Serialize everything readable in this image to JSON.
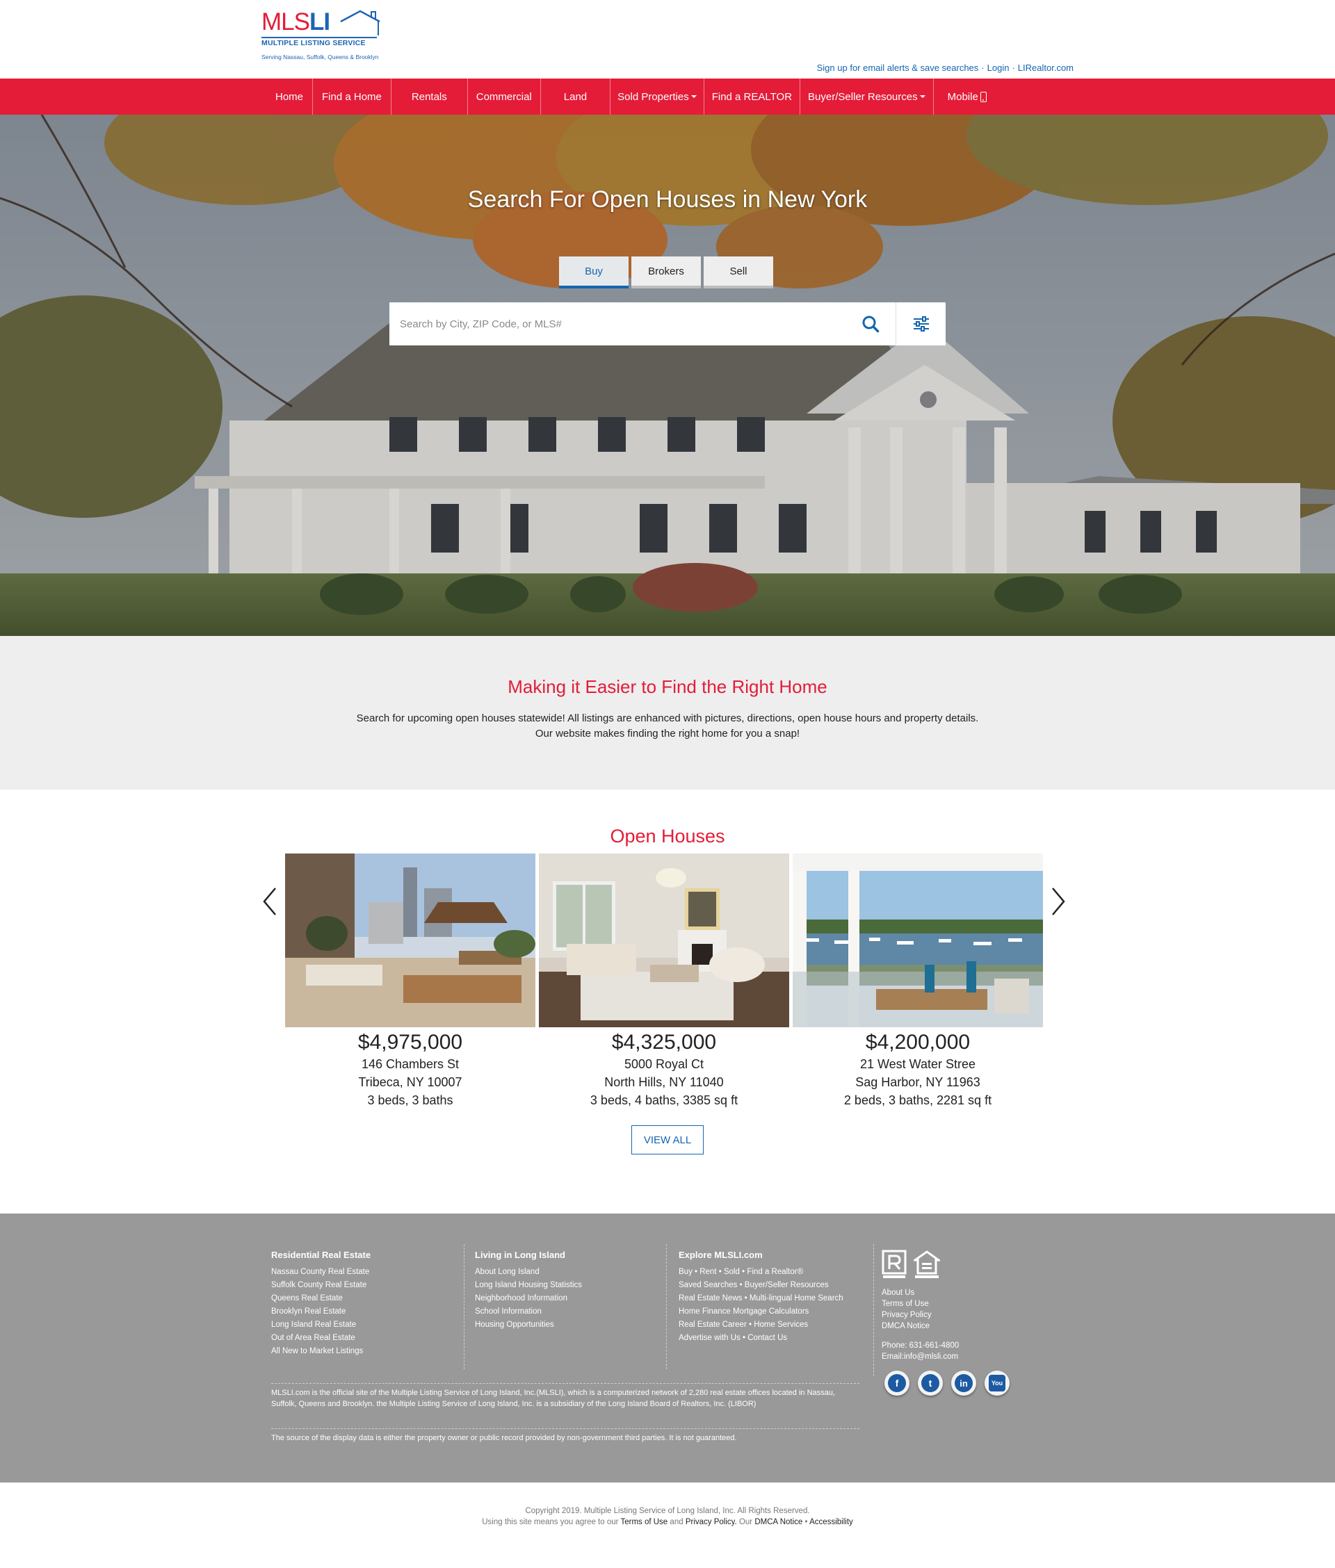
{
  "header": {
    "logo": {
      "mls": "MLS",
      "li": "LI",
      "tagline": "MULTIPLE LISTING SERVICE",
      "serving": "Serving Nassau, Suffolk, Queens & Brooklyn"
    },
    "utility_links": [
      "Sign up for email alerts & save searches",
      "Login",
      "LIRealtor.com"
    ]
  },
  "nav": {
    "items": [
      {
        "label": "Home"
      },
      {
        "label": "Find a Home"
      },
      {
        "label": "Rentals"
      },
      {
        "label": "Commercial"
      },
      {
        "label": "Land"
      },
      {
        "label": "Sold Properties"
      },
      {
        "label": "Find a REALTOR"
      },
      {
        "label": "Buyer/Seller Resources"
      },
      {
        "label": "Mobile"
      }
    ]
  },
  "hero": {
    "title": "Search For Open Houses in New York",
    "tabs": [
      {
        "label": "Buy",
        "active": true
      },
      {
        "label": "Brokers",
        "active": false
      },
      {
        "label": "Sell",
        "active": false
      }
    ],
    "search": {
      "placeholder": "Search by City, ZIP Code, or MLS#",
      "value": ""
    }
  },
  "intro": {
    "heading": "Making it Easier to Find the Right Home",
    "line1": "Search for upcoming open houses statewide! All listings are enhanced with pictures, directions, open house hours and property details.",
    "line2": "Our website makes finding the right home for you a snap!"
  },
  "open_houses": {
    "heading": "Open Houses",
    "view_all": "VIEW ALL",
    "listings": [
      {
        "price": "$4,975,000",
        "street": "146 Chambers St",
        "city": "Tribeca, NY 10007",
        "details": "3 beds, 3 baths"
      },
      {
        "price": "$4,325,000",
        "street": "5000 Royal Ct",
        "city": "North Hills, NY 11040",
        "details": "3 beds, 4 baths, 3385 sq ft"
      },
      {
        "price": "$4,200,000",
        "street": "21 West Water Stree",
        "city": "Sag Harbor, NY 11963",
        "details": "2 beds, 3 baths, 2281 sq ft"
      }
    ]
  },
  "footer": {
    "col1": {
      "title": "Residential Real Estate",
      "links": [
        "Nassau County Real Estate",
        "Suffolk County Real Estate",
        "Queens Real Estate",
        "Brooklyn Real Estate",
        "Long Island Real Estate",
        "Out of Area Real Estate",
        "All New to Market Listings"
      ]
    },
    "col2": {
      "title": "Living in Long Island",
      "links": [
        "About Long Island",
        "Long Island Housing Statistics",
        "Neighborhood Information",
        "School Information",
        "Housing Opportunities"
      ]
    },
    "col3": {
      "title": "Explore MLSLI.com",
      "links": [
        "Buy • Rent • Sold • Find a Realtor®",
        "Saved Searches • Buyer/Seller Resources",
        "Real Estate News • Multi-lingual Home Search",
        "Home Finance Mortgage Calculators",
        "Real Estate Career • Home Services",
        "Advertise with Us • Contact Us"
      ]
    },
    "col4": {
      "links": [
        "About Us",
        "Terms of Use",
        "Privacy Policy",
        "DMCA Notice"
      ],
      "phone": "Phone: 631-661-4800",
      "email": "Email:info@mlsli.com"
    },
    "about": "MLSLI.com is the official site of the Multiple Listing Service of Long Island, Inc.(MLSLI), which is a computerized network of 2,280 real estate offices located in Nassau, Suffolk, Queens and Brooklyn. the Multiple Listing Service of Long Island, Inc. is a subsidiary of the Long Island Board of Realtors, Inc. (LIBOR)",
    "source": "The source of the display data is either the property owner or public record provided by non-government third parties. It is not guaranteed.",
    "social": [
      {
        "name": "facebook-icon",
        "glyph": "f"
      },
      {
        "name": "twitter-icon",
        "glyph": "t"
      },
      {
        "name": "linkedin-icon",
        "glyph": "in"
      },
      {
        "name": "youtube-icon",
        "glyph": "You"
      }
    ]
  },
  "bottom": {
    "copyright": "Copyright 2019. Multiple Listing Service of Long Island, Inc. All Rights Reserved.",
    "agree_prefix": "Using this site means you agree to our",
    "terms": "Terms of Use",
    "and": "and",
    "privacy": "Privacy Policy.",
    "our": "Our",
    "dmca": "DMCA Notice",
    "bullet": "•",
    "accessibility": "Accessibility"
  },
  "colors": {
    "brand_red": "#e41c38",
    "brand_blue": "#1466b0",
    "footer_gray": "#999999",
    "intro_gray": "#eeeeee"
  }
}
